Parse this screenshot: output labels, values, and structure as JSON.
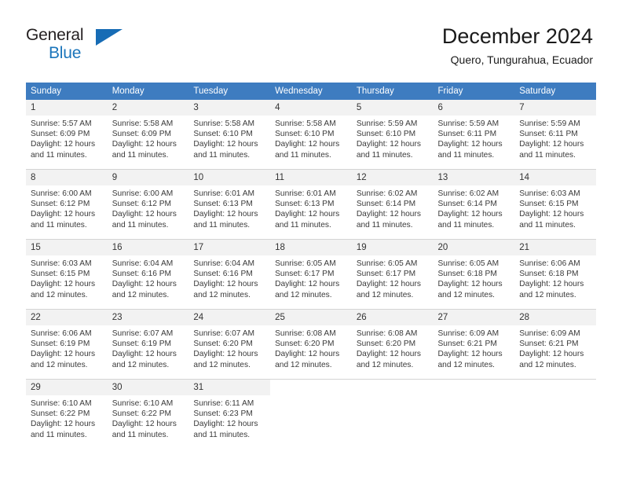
{
  "brand": {
    "name_top": "General",
    "name_bottom": "Blue",
    "triangle_color": "#176cb5",
    "blue_color": "#1b75bb"
  },
  "header": {
    "title": "December 2024",
    "subtitle": "Quero, Tungurahua, Ecuador",
    "header_bg": "#3e7cc0",
    "daynum_bg": "#f2f2f2"
  },
  "weekday_headers": [
    "Sunday",
    "Monday",
    "Tuesday",
    "Wednesday",
    "Thursday",
    "Friday",
    "Saturday"
  ],
  "weeks": [
    {
      "days": [
        {
          "num": "1",
          "sunrise": "Sunrise: 5:57 AM",
          "sunset": "Sunset: 6:09 PM",
          "daylight": "Daylight: 12 hours and 11 minutes."
        },
        {
          "num": "2",
          "sunrise": "Sunrise: 5:58 AM",
          "sunset": "Sunset: 6:09 PM",
          "daylight": "Daylight: 12 hours and 11 minutes."
        },
        {
          "num": "3",
          "sunrise": "Sunrise: 5:58 AM",
          "sunset": "Sunset: 6:10 PM",
          "daylight": "Daylight: 12 hours and 11 minutes."
        },
        {
          "num": "4",
          "sunrise": "Sunrise: 5:58 AM",
          "sunset": "Sunset: 6:10 PM",
          "daylight": "Daylight: 12 hours and 11 minutes."
        },
        {
          "num": "5",
          "sunrise": "Sunrise: 5:59 AM",
          "sunset": "Sunset: 6:10 PM",
          "daylight": "Daylight: 12 hours and 11 minutes."
        },
        {
          "num": "6",
          "sunrise": "Sunrise: 5:59 AM",
          "sunset": "Sunset: 6:11 PM",
          "daylight": "Daylight: 12 hours and 11 minutes."
        },
        {
          "num": "7",
          "sunrise": "Sunrise: 5:59 AM",
          "sunset": "Sunset: 6:11 PM",
          "daylight": "Daylight: 12 hours and 11 minutes."
        }
      ]
    },
    {
      "days": [
        {
          "num": "8",
          "sunrise": "Sunrise: 6:00 AM",
          "sunset": "Sunset: 6:12 PM",
          "daylight": "Daylight: 12 hours and 11 minutes."
        },
        {
          "num": "9",
          "sunrise": "Sunrise: 6:00 AM",
          "sunset": "Sunset: 6:12 PM",
          "daylight": "Daylight: 12 hours and 11 minutes."
        },
        {
          "num": "10",
          "sunrise": "Sunrise: 6:01 AM",
          "sunset": "Sunset: 6:13 PM",
          "daylight": "Daylight: 12 hours and 11 minutes."
        },
        {
          "num": "11",
          "sunrise": "Sunrise: 6:01 AM",
          "sunset": "Sunset: 6:13 PM",
          "daylight": "Daylight: 12 hours and 11 minutes."
        },
        {
          "num": "12",
          "sunrise": "Sunrise: 6:02 AM",
          "sunset": "Sunset: 6:14 PM",
          "daylight": "Daylight: 12 hours and 11 minutes."
        },
        {
          "num": "13",
          "sunrise": "Sunrise: 6:02 AM",
          "sunset": "Sunset: 6:14 PM",
          "daylight": "Daylight: 12 hours and 11 minutes."
        },
        {
          "num": "14",
          "sunrise": "Sunrise: 6:03 AM",
          "sunset": "Sunset: 6:15 PM",
          "daylight": "Daylight: 12 hours and 11 minutes."
        }
      ]
    },
    {
      "days": [
        {
          "num": "15",
          "sunrise": "Sunrise: 6:03 AM",
          "sunset": "Sunset: 6:15 PM",
          "daylight": "Daylight: 12 hours and 12 minutes."
        },
        {
          "num": "16",
          "sunrise": "Sunrise: 6:04 AM",
          "sunset": "Sunset: 6:16 PM",
          "daylight": "Daylight: 12 hours and 12 minutes."
        },
        {
          "num": "17",
          "sunrise": "Sunrise: 6:04 AM",
          "sunset": "Sunset: 6:16 PM",
          "daylight": "Daylight: 12 hours and 12 minutes."
        },
        {
          "num": "18",
          "sunrise": "Sunrise: 6:05 AM",
          "sunset": "Sunset: 6:17 PM",
          "daylight": "Daylight: 12 hours and 12 minutes."
        },
        {
          "num": "19",
          "sunrise": "Sunrise: 6:05 AM",
          "sunset": "Sunset: 6:17 PM",
          "daylight": "Daylight: 12 hours and 12 minutes."
        },
        {
          "num": "20",
          "sunrise": "Sunrise: 6:05 AM",
          "sunset": "Sunset: 6:18 PM",
          "daylight": "Daylight: 12 hours and 12 minutes."
        },
        {
          "num": "21",
          "sunrise": "Sunrise: 6:06 AM",
          "sunset": "Sunset: 6:18 PM",
          "daylight": "Daylight: 12 hours and 12 minutes."
        }
      ]
    },
    {
      "days": [
        {
          "num": "22",
          "sunrise": "Sunrise: 6:06 AM",
          "sunset": "Sunset: 6:19 PM",
          "daylight": "Daylight: 12 hours and 12 minutes."
        },
        {
          "num": "23",
          "sunrise": "Sunrise: 6:07 AM",
          "sunset": "Sunset: 6:19 PM",
          "daylight": "Daylight: 12 hours and 12 minutes."
        },
        {
          "num": "24",
          "sunrise": "Sunrise: 6:07 AM",
          "sunset": "Sunset: 6:20 PM",
          "daylight": "Daylight: 12 hours and 12 minutes."
        },
        {
          "num": "25",
          "sunrise": "Sunrise: 6:08 AM",
          "sunset": "Sunset: 6:20 PM",
          "daylight": "Daylight: 12 hours and 12 minutes."
        },
        {
          "num": "26",
          "sunrise": "Sunrise: 6:08 AM",
          "sunset": "Sunset: 6:20 PM",
          "daylight": "Daylight: 12 hours and 12 minutes."
        },
        {
          "num": "27",
          "sunrise": "Sunrise: 6:09 AM",
          "sunset": "Sunset: 6:21 PM",
          "daylight": "Daylight: 12 hours and 12 minutes."
        },
        {
          "num": "28",
          "sunrise": "Sunrise: 6:09 AM",
          "sunset": "Sunset: 6:21 PM",
          "daylight": "Daylight: 12 hours and 12 minutes."
        }
      ]
    },
    {
      "days": [
        {
          "num": "29",
          "sunrise": "Sunrise: 6:10 AM",
          "sunset": "Sunset: 6:22 PM",
          "daylight": "Daylight: 12 hours and 11 minutes."
        },
        {
          "num": "30",
          "sunrise": "Sunrise: 6:10 AM",
          "sunset": "Sunset: 6:22 PM",
          "daylight": "Daylight: 12 hours and 11 minutes."
        },
        {
          "num": "31",
          "sunrise": "Sunrise: 6:11 AM",
          "sunset": "Sunset: 6:23 PM",
          "daylight": "Daylight: 12 hours and 11 minutes."
        },
        {
          "num": "",
          "sunrise": "",
          "sunset": "",
          "daylight": ""
        },
        {
          "num": "",
          "sunrise": "",
          "sunset": "",
          "daylight": ""
        },
        {
          "num": "",
          "sunrise": "",
          "sunset": "",
          "daylight": ""
        },
        {
          "num": "",
          "sunrise": "",
          "sunset": "",
          "daylight": ""
        }
      ]
    }
  ]
}
